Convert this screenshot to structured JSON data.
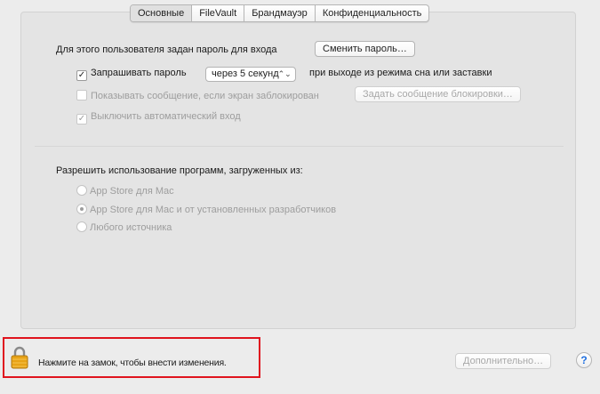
{
  "tabs": [
    {
      "label": "Основные",
      "active": true
    },
    {
      "label": "FileVault",
      "active": false
    },
    {
      "label": "Брандмауэр",
      "active": false
    },
    {
      "label": "Конфиденциальность",
      "active": false
    }
  ],
  "password": {
    "label": "Для этого пользователя задан пароль для входа",
    "change_button": "Сменить пароль…",
    "require_checkbox_label": "Запрашивать пароль",
    "require_checked": true,
    "delay_value": "через 5 секунд",
    "require_suffix": "при выходе из режима сна или заставки",
    "show_message_label": "Показывать сообщение, если экран заблокирован",
    "show_message_checked": false,
    "set_message_button": "Задать сообщение блокировки…",
    "disable_autologin_label": "Выключить автоматический вход",
    "disable_autologin_checked": true
  },
  "apps": {
    "label": "Разрешить использование программ, загруженных из:",
    "options": [
      {
        "label": "App Store для Mac",
        "selected": false
      },
      {
        "label": "App Store для Mac и от установленных разработчиков",
        "selected": true
      },
      {
        "label": "Любого источника",
        "selected": false
      }
    ]
  },
  "footer": {
    "lock_text": "Нажмите на замок, чтобы внести изменения.",
    "advanced_button": "Дополнительно…",
    "help_glyph": "?"
  },
  "colors": {
    "highlight_border": "#e0141e",
    "lock_body": "#e8a317"
  }
}
